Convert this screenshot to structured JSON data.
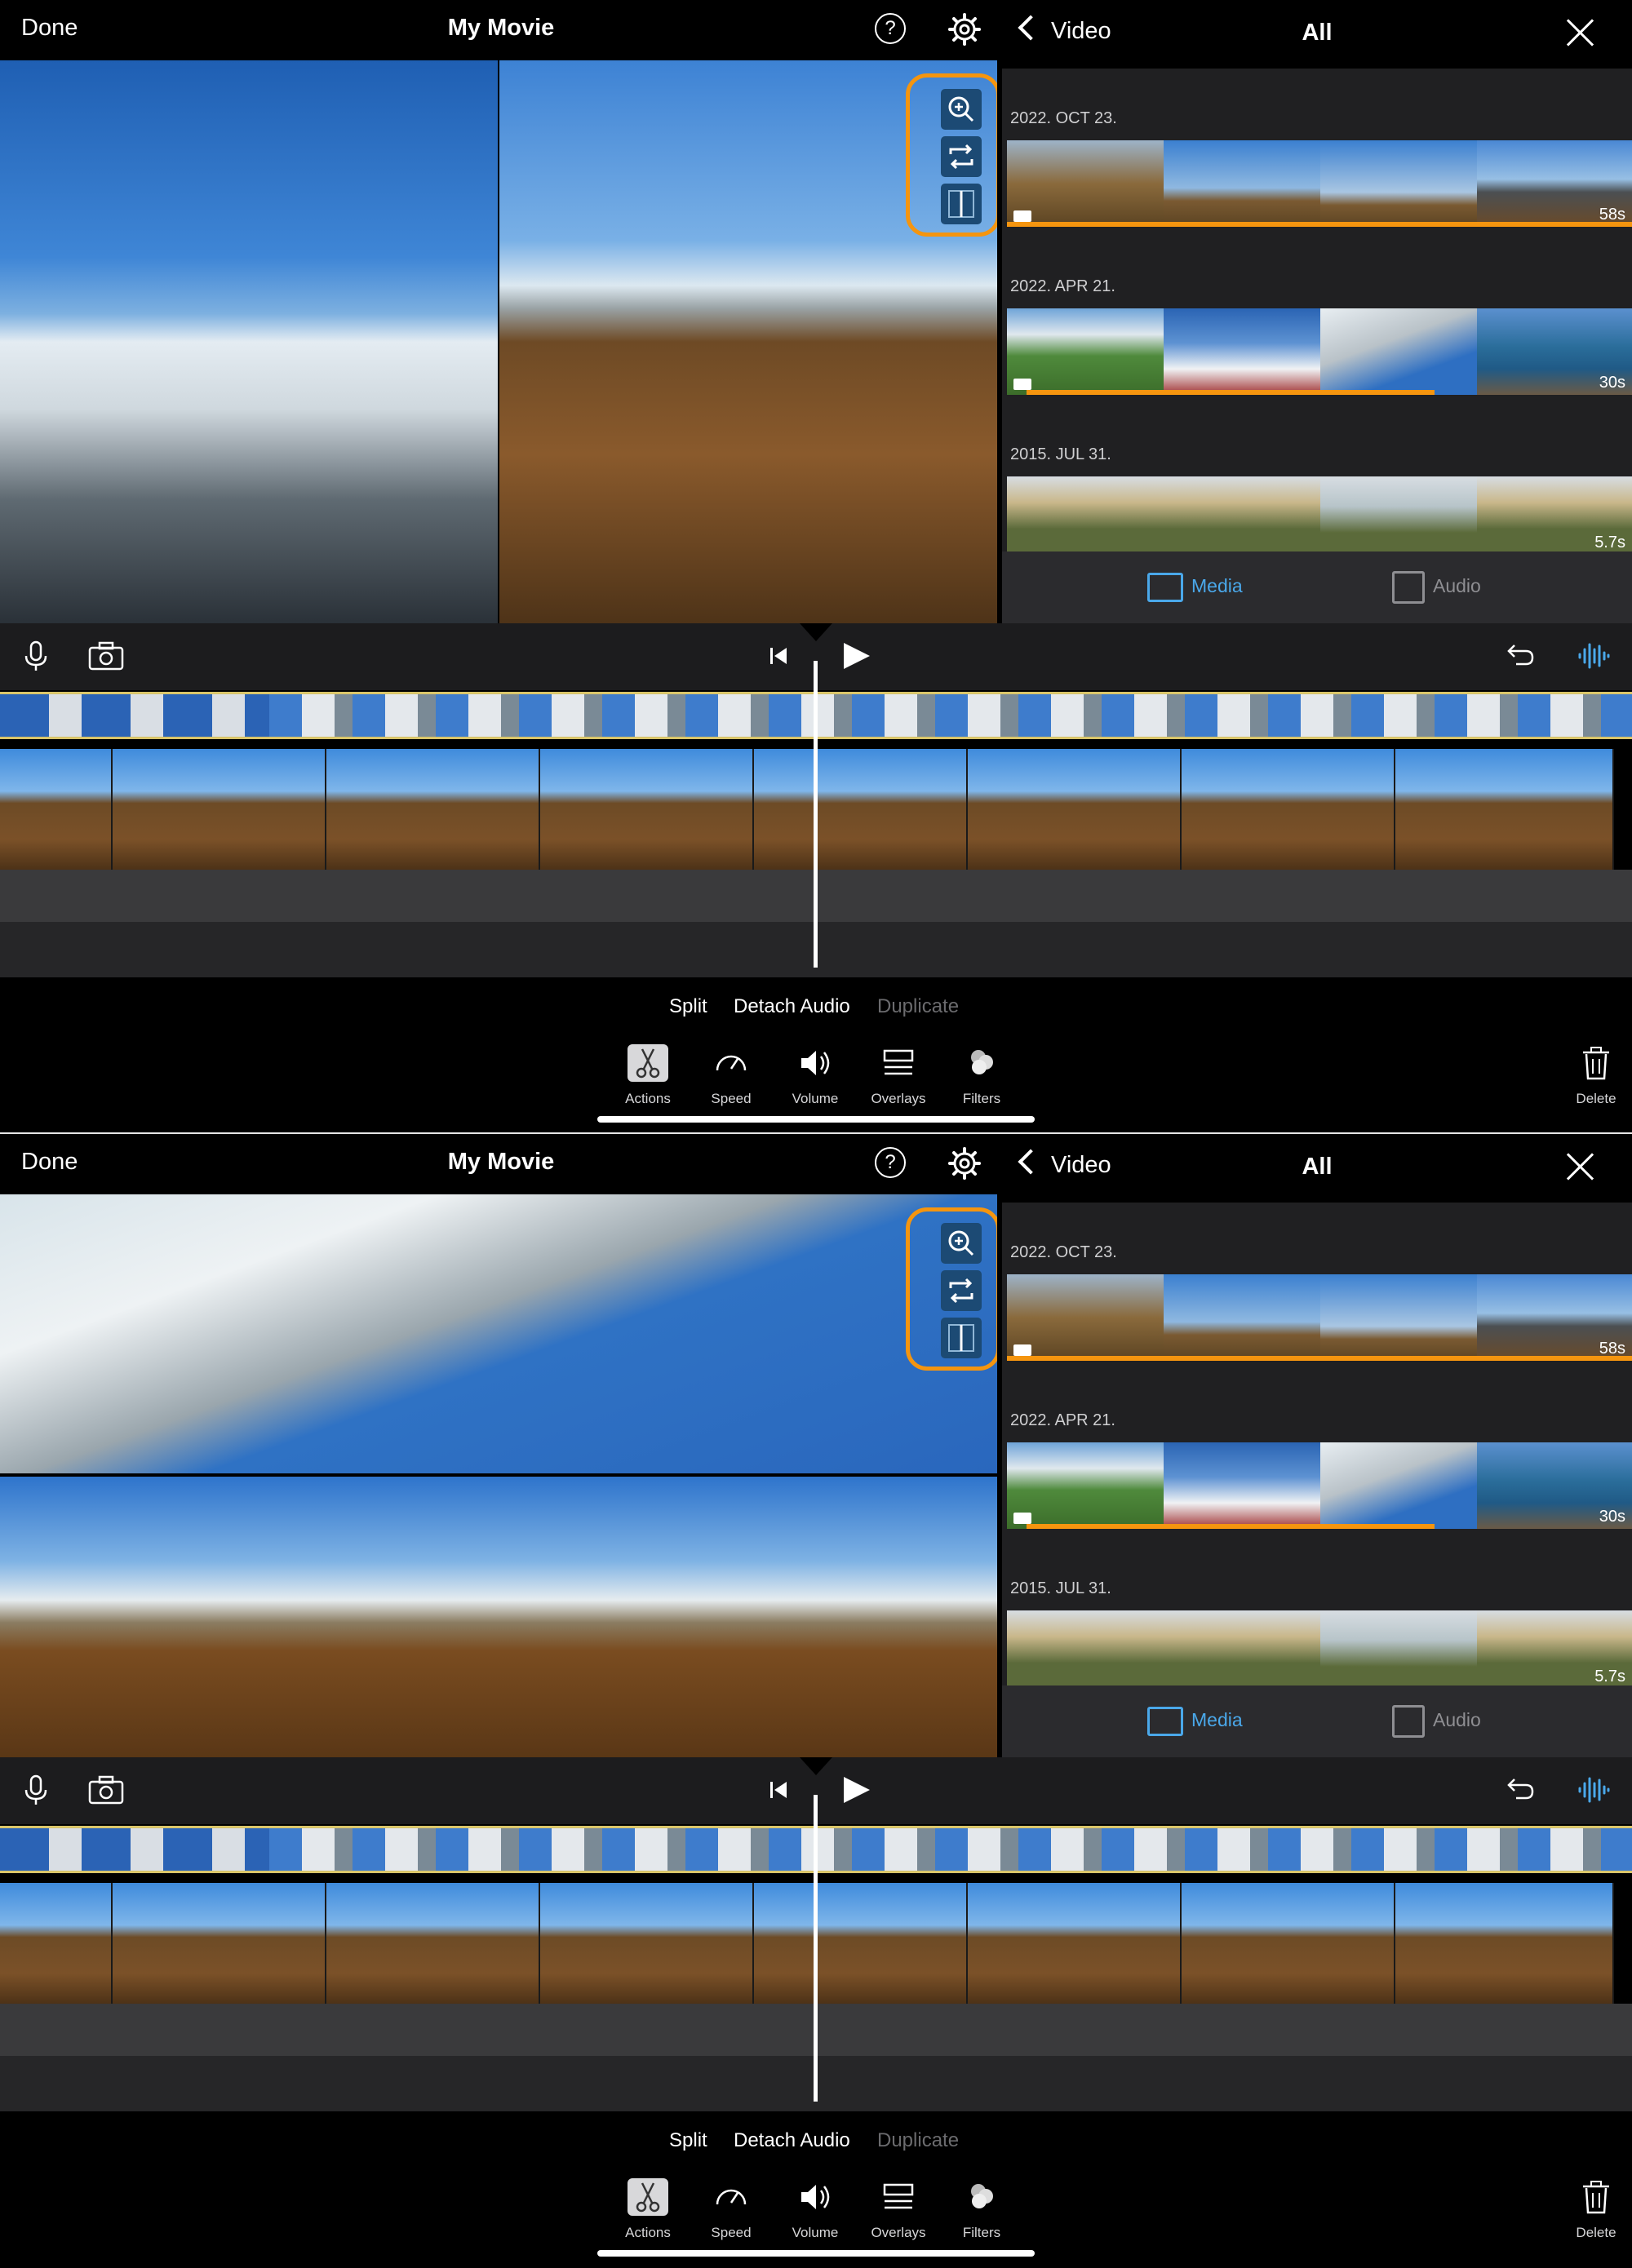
{
  "header": {
    "done_label": "Done",
    "title": "My Movie",
    "help_glyph": "?",
    "settings_icon": "gear-icon"
  },
  "viewer_top": {
    "layout": "side-by-side",
    "overlay_icons": [
      "zoom-icon",
      "swap-icon",
      "split-screen-icon"
    ]
  },
  "viewer_bottom": {
    "layout": "top-bottom",
    "overlay_icons": [
      "zoom-icon",
      "swap-icon",
      "split-screen-icon"
    ]
  },
  "browser": {
    "back_label": "Video",
    "title": "All",
    "sections": [
      {
        "date": "2022. OCT 23.",
        "duration": "58s"
      },
      {
        "date": "2022. APR 21.",
        "duration": "30s"
      },
      {
        "date": "2015. JUL 31.",
        "duration": "5.7s"
      }
    ],
    "tabs": {
      "media": "Media",
      "audio": "Audio"
    },
    "accent_color": "#4aa8ea",
    "highlight_color": "#f5950f"
  },
  "actions": {
    "split": "Split",
    "detach_audio": "Detach Audio",
    "duplicate": "Duplicate"
  },
  "bottom_tabs": {
    "actions": "Actions",
    "speed": "Speed",
    "volume": "Volume",
    "overlays": "Overlays",
    "filters": "Filters",
    "delete": "Delete"
  }
}
